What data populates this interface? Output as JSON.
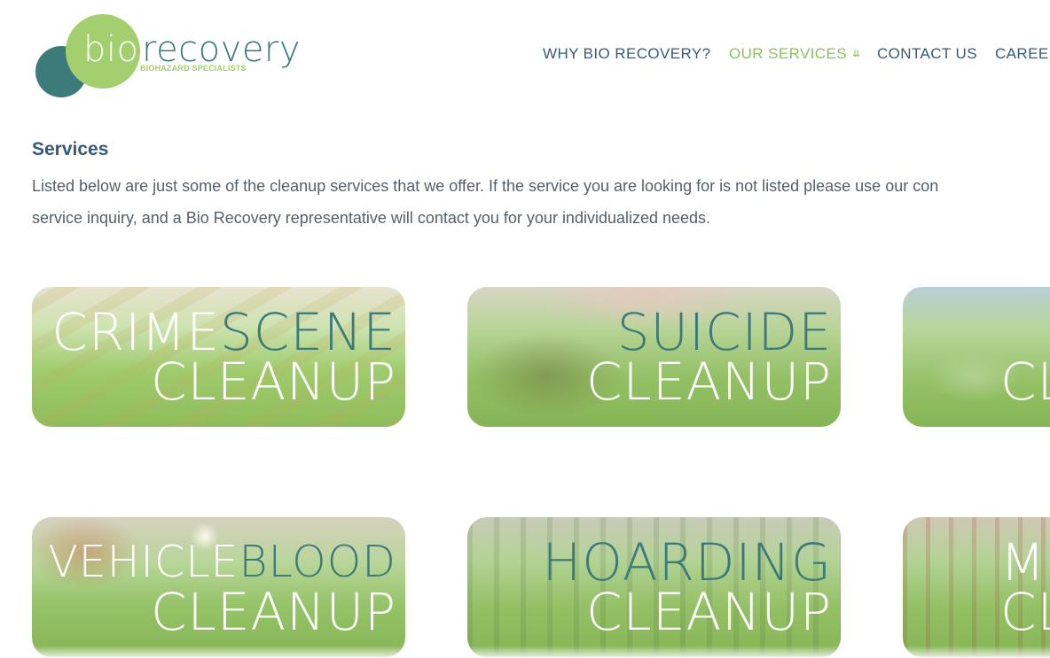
{
  "logo": {
    "word_light": "bio",
    "word_dark": "recovery",
    "tagline": "BIOHAZARD SPECIALISTS"
  },
  "nav": {
    "items": [
      {
        "label": "WHY BIO RECOVERY?"
      },
      {
        "label": "OUR SERVICES",
        "active": true,
        "icon": "double-chevron-down-icon"
      },
      {
        "label": "CONTACT US"
      },
      {
        "label": "CAREEI"
      }
    ]
  },
  "content": {
    "heading": "Services",
    "intro_line1": "Listed below are just some of the cleanup services that we offer. If the service you are looking for is not listed please use our con",
    "intro_line2": "service inquiry, and a Bio Recovery representative will contact you for your individualized needs."
  },
  "cards": [
    {
      "line1_white": "CRIME",
      "line1_green": "SCENE",
      "line2": "CLEANUP"
    },
    {
      "line1_white": "",
      "line1_green": "SUICIDE",
      "line2": "CLEANUP"
    },
    {
      "line1_white": "",
      "line1_green": "",
      "line2": "CL"
    },
    {
      "line1_white": "VEHICLE",
      "line1_green": "BLOOD",
      "line2": "CLEANUP"
    },
    {
      "line1_white": "",
      "line1_green": "HOARDING",
      "line2": "CLEANUP"
    },
    {
      "line1_white": "M",
      "line1_green": "",
      "line2": "CL"
    }
  ],
  "colors": {
    "navy": "#375a79",
    "teal": "#3d7b7a",
    "green": "#a4cf6e",
    "nav_active": "#8dc05e",
    "body_text": "#55606a"
  }
}
